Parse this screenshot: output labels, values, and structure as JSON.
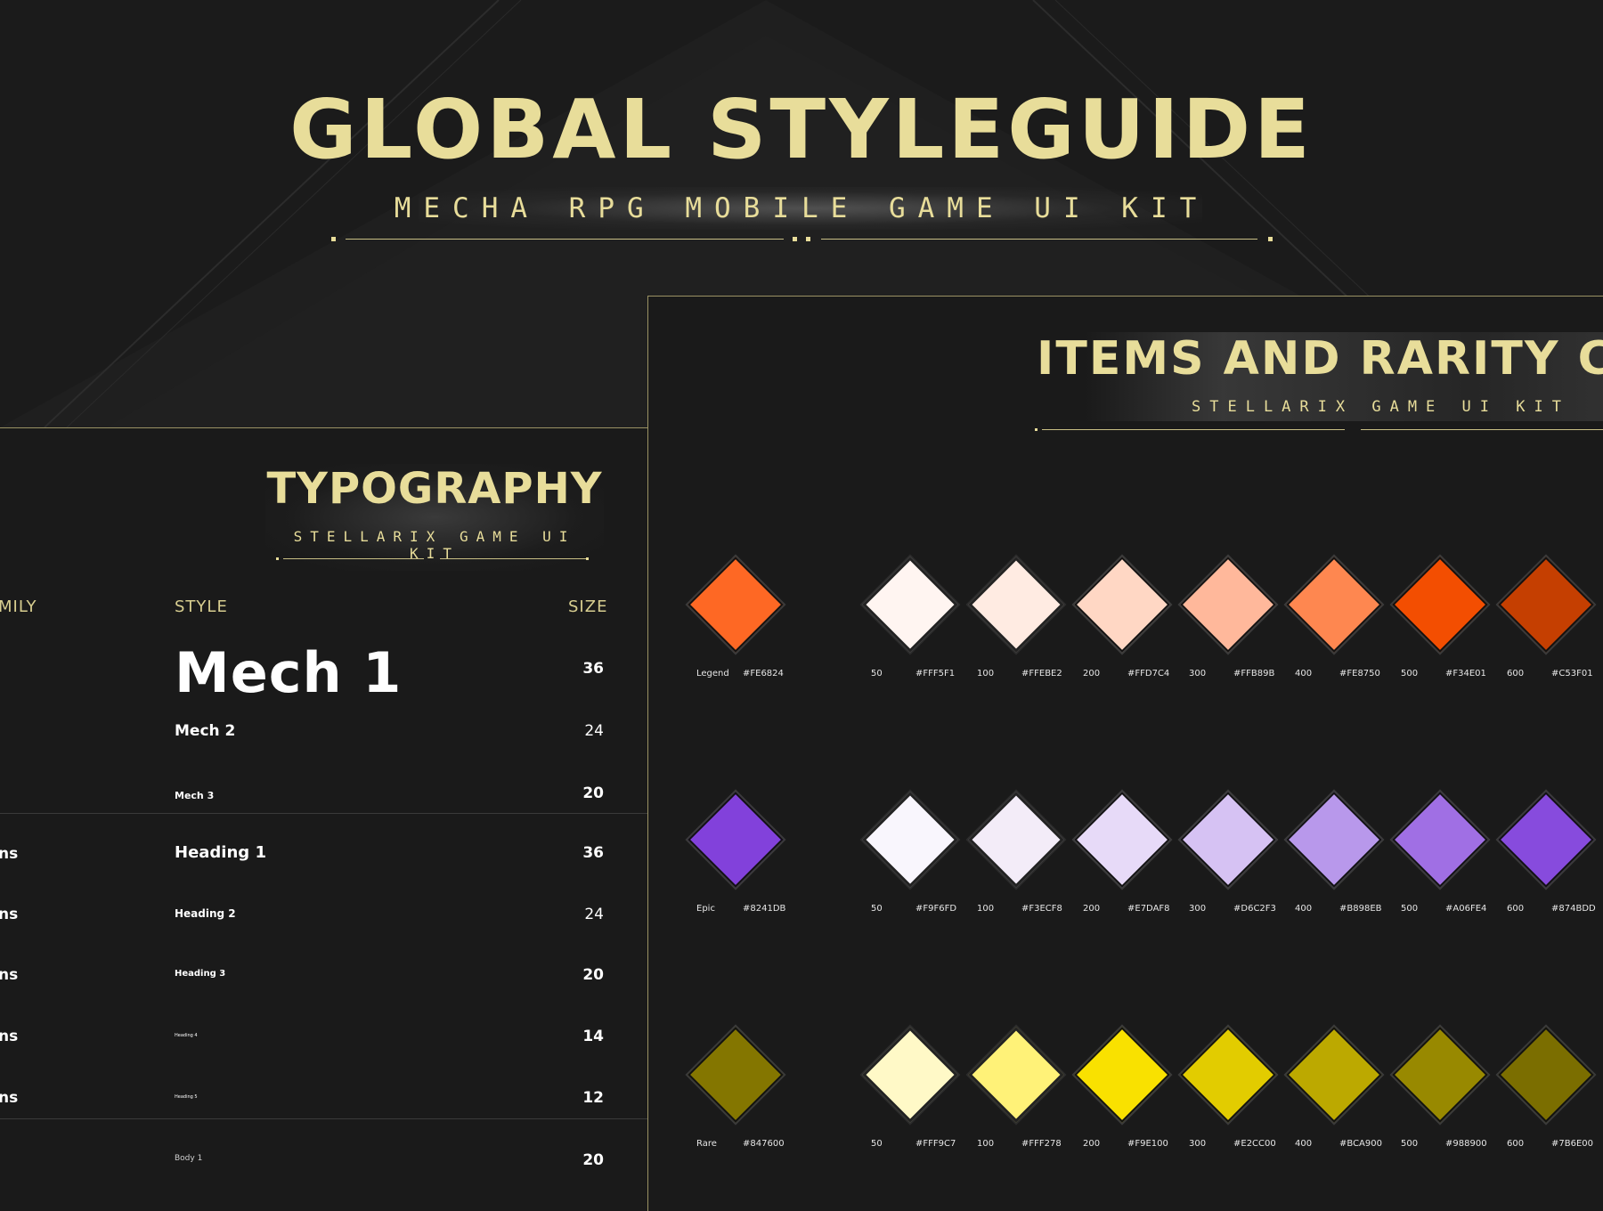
{
  "header": {
    "title": "GLOBAL STYLEGUIDE",
    "subtitle": "MECHA RPG MOBILE GAME UI KIT"
  },
  "typography": {
    "title": "TYPOGRAPHY",
    "subtitle": "STELLARIX GAME UI KIT",
    "columns": {
      "family": "MILY",
      "style": "STYLE",
      "size": "SIZE"
    },
    "rows": [
      {
        "family": "",
        "style": "Mech 1",
        "size": "36"
      },
      {
        "family": "",
        "style": "Mech 2",
        "size": "24"
      },
      {
        "family": "",
        "style": "Mech 3",
        "size": "20"
      },
      {
        "family": "ns",
        "style": "Heading 1",
        "size": "36"
      },
      {
        "family": "ns",
        "style": "Heading 2",
        "size": "24"
      },
      {
        "family": "ns",
        "style": "Heading 3",
        "size": "20"
      },
      {
        "family": "ns",
        "style": "Heading 4",
        "size": "14"
      },
      {
        "family": "ns",
        "style": "Heading 5",
        "size": "12"
      },
      {
        "family": "",
        "style": "Body 1",
        "size": "20"
      }
    ]
  },
  "items": {
    "title": "ITEMS AND RARITY COLO",
    "subtitle": "STELLARIX GAME UI KIT",
    "rows": [
      {
        "name": "Legend",
        "base": "#FE6824",
        "shades": [
          {
            "step": "50",
            "hex": "#FFF5F1"
          },
          {
            "step": "100",
            "hex": "#FFEBE2"
          },
          {
            "step": "200",
            "hex": "#FFD7C4"
          },
          {
            "step": "300",
            "hex": "#FFB89B"
          },
          {
            "step": "400",
            "hex": "#FE8750"
          },
          {
            "step": "500",
            "hex": "#F34E01"
          },
          {
            "step": "600",
            "hex": "#C53F01"
          }
        ]
      },
      {
        "name": "Epic",
        "base": "#8241DB",
        "shades": [
          {
            "step": "50",
            "hex": "#F9F6FD"
          },
          {
            "step": "100",
            "hex": "#F3ECF8"
          },
          {
            "step": "200",
            "hex": "#E7DAF8"
          },
          {
            "step": "300",
            "hex": "#D6C2F3"
          },
          {
            "step": "400",
            "hex": "#B898EB"
          },
          {
            "step": "500",
            "hex": "#A06FE4"
          },
          {
            "step": "600",
            "hex": "#874BDD"
          }
        ]
      },
      {
        "name": "Rare",
        "base": "#847600",
        "shades": [
          {
            "step": "50",
            "hex": "#FFF9C7"
          },
          {
            "step": "100",
            "hex": "#FFF278"
          },
          {
            "step": "200",
            "hex": "#F9E100"
          },
          {
            "step": "300",
            "hex": "#E2CC00"
          },
          {
            "step": "400",
            "hex": "#BCA900"
          },
          {
            "step": "500",
            "hex": "#988900"
          },
          {
            "step": "600",
            "hex": "#7B6E00"
          }
        ]
      }
    ]
  }
}
